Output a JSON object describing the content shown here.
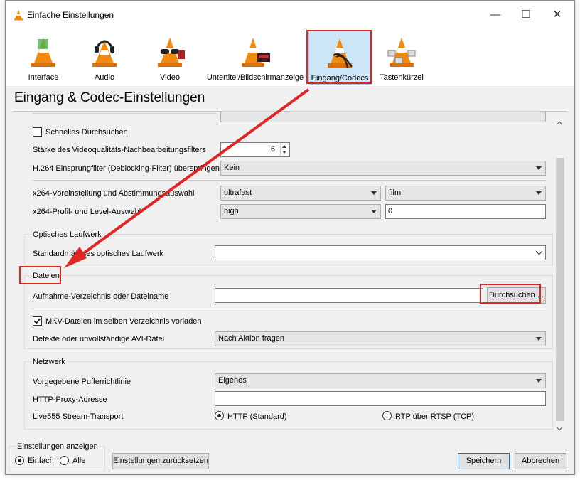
{
  "window": {
    "title": "Einfache Einstellungen"
  },
  "toolbar": {
    "items": [
      {
        "label": "Interface"
      },
      {
        "label": "Audio"
      },
      {
        "label": "Video"
      },
      {
        "label": "Untertitel/Bildschirmanzeige"
      },
      {
        "label": "Eingang/Codecs",
        "active": true
      },
      {
        "label": "Tastenkürzel"
      }
    ]
  },
  "page": {
    "title": "Eingang & Codec-Einstellungen"
  },
  "codecs": {
    "fast_seek_label": "Schnelles Durchsuchen",
    "fast_seek_checked": false,
    "pp_label": "Stärke des Videoqualitäts-Nachbearbeitungsfilters",
    "pp_value": "6",
    "h264_label": "H.264 Einsprungfilter (Deblocking-Filter) überspringen",
    "h264_value": "Kein",
    "x264_preset_label": "x264-Voreinstellung und Abstimmungsauswahl",
    "x264_preset_value": "ultrafast",
    "x264_tune_value": "film",
    "x264_profile_label": "x264-Profil- und Level-Auswahl",
    "x264_profile_value": "high",
    "x264_level_value": "0"
  },
  "optical": {
    "group_title": "Optisches Laufwerk",
    "default_label": "Standardmäßiges optisches Laufwerk",
    "default_value": ""
  },
  "files": {
    "group_title": "Dateien",
    "record_label": "Aufnahme-Verzeichnis oder Dateiname",
    "record_value": "",
    "browse_label": "Durchsuchen ...",
    "mkv_label": "MKV-Dateien im selben Verzeichnis vorladen",
    "mkv_checked": true,
    "avi_label": "Defekte oder unvollständige AVI-Datei",
    "avi_value": "Nach Aktion fragen"
  },
  "network": {
    "group_title": "Netzwerk",
    "cache_label": "Vorgegebene Pufferrichtlinie",
    "cache_value": "Eigenes",
    "proxy_label": "HTTP-Proxy-Adresse",
    "proxy_value": "",
    "live555_label": "Live555 Stream-Transport",
    "http_label": "HTTP (Standard)",
    "rtp_label": "RTP über RTSP (TCP)",
    "selected": "HTTP (Standard)"
  },
  "footer": {
    "show_group": "Einstellungen anzeigen",
    "simple_label": "Einfach",
    "all_label": "Alle",
    "selected": "Einfach",
    "reset_label": "Einstellungen zurücksetzen",
    "save_label": "Speichern",
    "cancel_label": "Abbrechen"
  },
  "colors": {
    "highlight": "#e02525",
    "tab_active": "#cde6f7",
    "cone_orange": "#f08a12"
  }
}
